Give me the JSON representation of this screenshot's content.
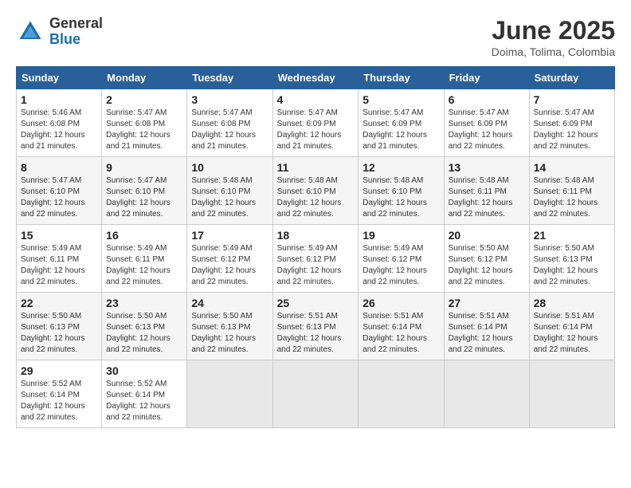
{
  "logo": {
    "general": "General",
    "blue": "Blue"
  },
  "title": {
    "month_year": "June 2025",
    "location": "Doima, Tolima, Colombia"
  },
  "weekdays": [
    "Sunday",
    "Monday",
    "Tuesday",
    "Wednesday",
    "Thursday",
    "Friday",
    "Saturday"
  ],
  "weeks": [
    [
      {
        "day": "1",
        "sunrise": "5:46 AM",
        "sunset": "6:08 PM",
        "daylight": "12 hours and 21 minutes."
      },
      {
        "day": "2",
        "sunrise": "5:47 AM",
        "sunset": "6:08 PM",
        "daylight": "12 hours and 21 minutes."
      },
      {
        "day": "3",
        "sunrise": "5:47 AM",
        "sunset": "6:08 PM",
        "daylight": "12 hours and 21 minutes."
      },
      {
        "day": "4",
        "sunrise": "5:47 AM",
        "sunset": "6:09 PM",
        "daylight": "12 hours and 21 minutes."
      },
      {
        "day": "5",
        "sunrise": "5:47 AM",
        "sunset": "6:09 PM",
        "daylight": "12 hours and 21 minutes."
      },
      {
        "day": "6",
        "sunrise": "5:47 AM",
        "sunset": "6:09 PM",
        "daylight": "12 hours and 22 minutes."
      },
      {
        "day": "7",
        "sunrise": "5:47 AM",
        "sunset": "6:09 PM",
        "daylight": "12 hours and 22 minutes."
      }
    ],
    [
      {
        "day": "8",
        "sunrise": "5:47 AM",
        "sunset": "6:10 PM",
        "daylight": "12 hours and 22 minutes."
      },
      {
        "day": "9",
        "sunrise": "5:47 AM",
        "sunset": "6:10 PM",
        "daylight": "12 hours and 22 minutes."
      },
      {
        "day": "10",
        "sunrise": "5:48 AM",
        "sunset": "6:10 PM",
        "daylight": "12 hours and 22 minutes."
      },
      {
        "day": "11",
        "sunrise": "5:48 AM",
        "sunset": "6:10 PM",
        "daylight": "12 hours and 22 minutes."
      },
      {
        "day": "12",
        "sunrise": "5:48 AM",
        "sunset": "6:10 PM",
        "daylight": "12 hours and 22 minutes."
      },
      {
        "day": "13",
        "sunrise": "5:48 AM",
        "sunset": "6:11 PM",
        "daylight": "12 hours and 22 minutes."
      },
      {
        "day": "14",
        "sunrise": "5:48 AM",
        "sunset": "6:11 PM",
        "daylight": "12 hours and 22 minutes."
      }
    ],
    [
      {
        "day": "15",
        "sunrise": "5:49 AM",
        "sunset": "6:11 PM",
        "daylight": "12 hours and 22 minutes."
      },
      {
        "day": "16",
        "sunrise": "5:49 AM",
        "sunset": "6:11 PM",
        "daylight": "12 hours and 22 minutes."
      },
      {
        "day": "17",
        "sunrise": "5:49 AM",
        "sunset": "6:12 PM",
        "daylight": "12 hours and 22 minutes."
      },
      {
        "day": "18",
        "sunrise": "5:49 AM",
        "sunset": "6:12 PM",
        "daylight": "12 hours and 22 minutes."
      },
      {
        "day": "19",
        "sunrise": "5:49 AM",
        "sunset": "6:12 PM",
        "daylight": "12 hours and 22 minutes."
      },
      {
        "day": "20",
        "sunrise": "5:50 AM",
        "sunset": "6:12 PM",
        "daylight": "12 hours and 22 minutes."
      },
      {
        "day": "21",
        "sunrise": "5:50 AM",
        "sunset": "6:13 PM",
        "daylight": "12 hours and 22 minutes."
      }
    ],
    [
      {
        "day": "22",
        "sunrise": "5:50 AM",
        "sunset": "6:13 PM",
        "daylight": "12 hours and 22 minutes."
      },
      {
        "day": "23",
        "sunrise": "5:50 AM",
        "sunset": "6:13 PM",
        "daylight": "12 hours and 22 minutes."
      },
      {
        "day": "24",
        "sunrise": "5:50 AM",
        "sunset": "6:13 PM",
        "daylight": "12 hours and 22 minutes."
      },
      {
        "day": "25",
        "sunrise": "5:51 AM",
        "sunset": "6:13 PM",
        "daylight": "12 hours and 22 minutes."
      },
      {
        "day": "26",
        "sunrise": "5:51 AM",
        "sunset": "6:14 PM",
        "daylight": "12 hours and 22 minutes."
      },
      {
        "day": "27",
        "sunrise": "5:51 AM",
        "sunset": "6:14 PM",
        "daylight": "12 hours and 22 minutes."
      },
      {
        "day": "28",
        "sunrise": "5:51 AM",
        "sunset": "6:14 PM",
        "daylight": "12 hours and 22 minutes."
      }
    ],
    [
      {
        "day": "29",
        "sunrise": "5:52 AM",
        "sunset": "6:14 PM",
        "daylight": "12 hours and 22 minutes."
      },
      {
        "day": "30",
        "sunrise": "5:52 AM",
        "sunset": "6:14 PM",
        "daylight": "12 hours and 22 minutes."
      },
      null,
      null,
      null,
      null,
      null
    ]
  ],
  "labels": {
    "sunrise": "Sunrise:",
    "sunset": "Sunset:",
    "daylight": "Daylight:"
  }
}
